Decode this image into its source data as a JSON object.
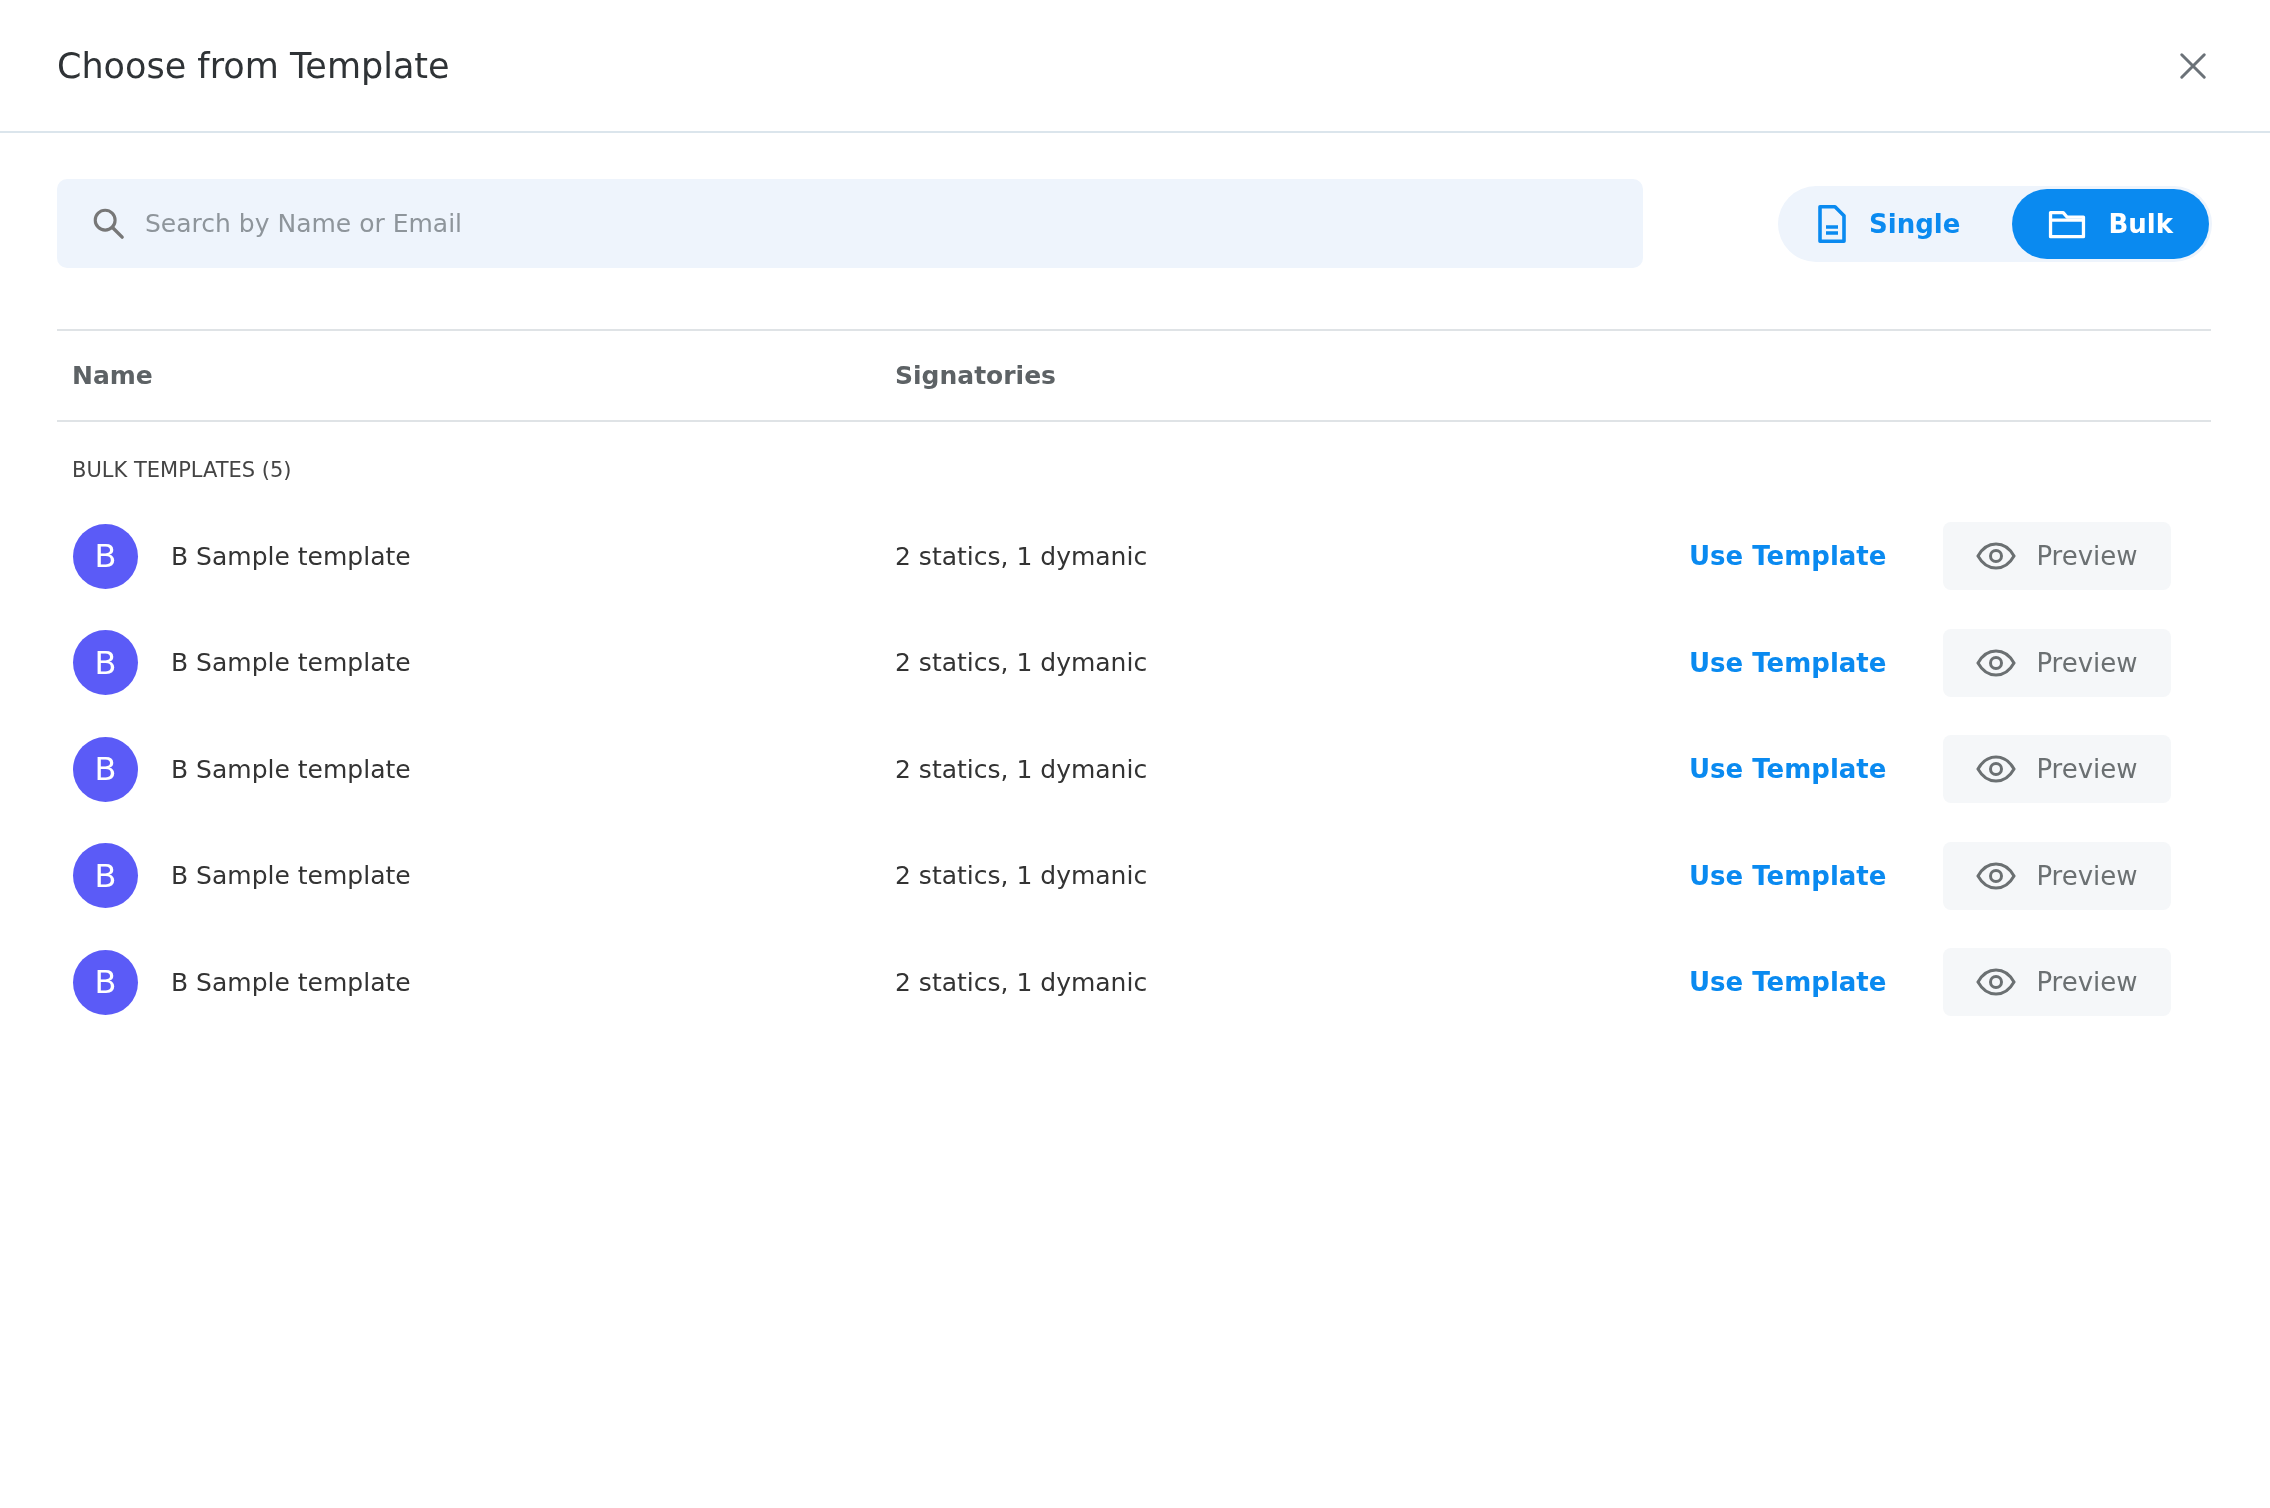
{
  "dialog": {
    "title": "Choose from Template"
  },
  "search": {
    "placeholder": "Search by Name or Email"
  },
  "view_toggle": [
    {
      "label": "Single",
      "kind": "document",
      "selected": false
    },
    {
      "label": "Bulk",
      "kind": "folder",
      "selected": true
    }
  ],
  "table": {
    "columns": [
      "Name",
      "Signatories"
    ],
    "section": "BULK TEMPLATES (5)",
    "rows": [
      {
        "avatar": "B",
        "name": "B Sample template",
        "signatories": "2 statics, 1 dymanic",
        "use_label": "Use Template",
        "preview_label": "Preview"
      },
      {
        "avatar": "B",
        "name": "B Sample template",
        "signatories": "2 statics, 1 dymanic",
        "use_label": "Use Template",
        "preview_label": "Preview"
      },
      {
        "avatar": "B",
        "name": "B Sample template",
        "signatories": "2 statics, 1 dymanic",
        "use_label": "Use Template",
        "preview_label": "Preview"
      },
      {
        "avatar": "B",
        "name": "B Sample template",
        "signatories": "2 statics, 1 dymanic",
        "use_label": "Use Template",
        "preview_label": "Preview"
      },
      {
        "avatar": "B",
        "name": "B Sample template",
        "signatories": "2 statics, 1 dymanic",
        "use_label": "Use Template",
        "preview_label": "Preview"
      }
    ]
  }
}
